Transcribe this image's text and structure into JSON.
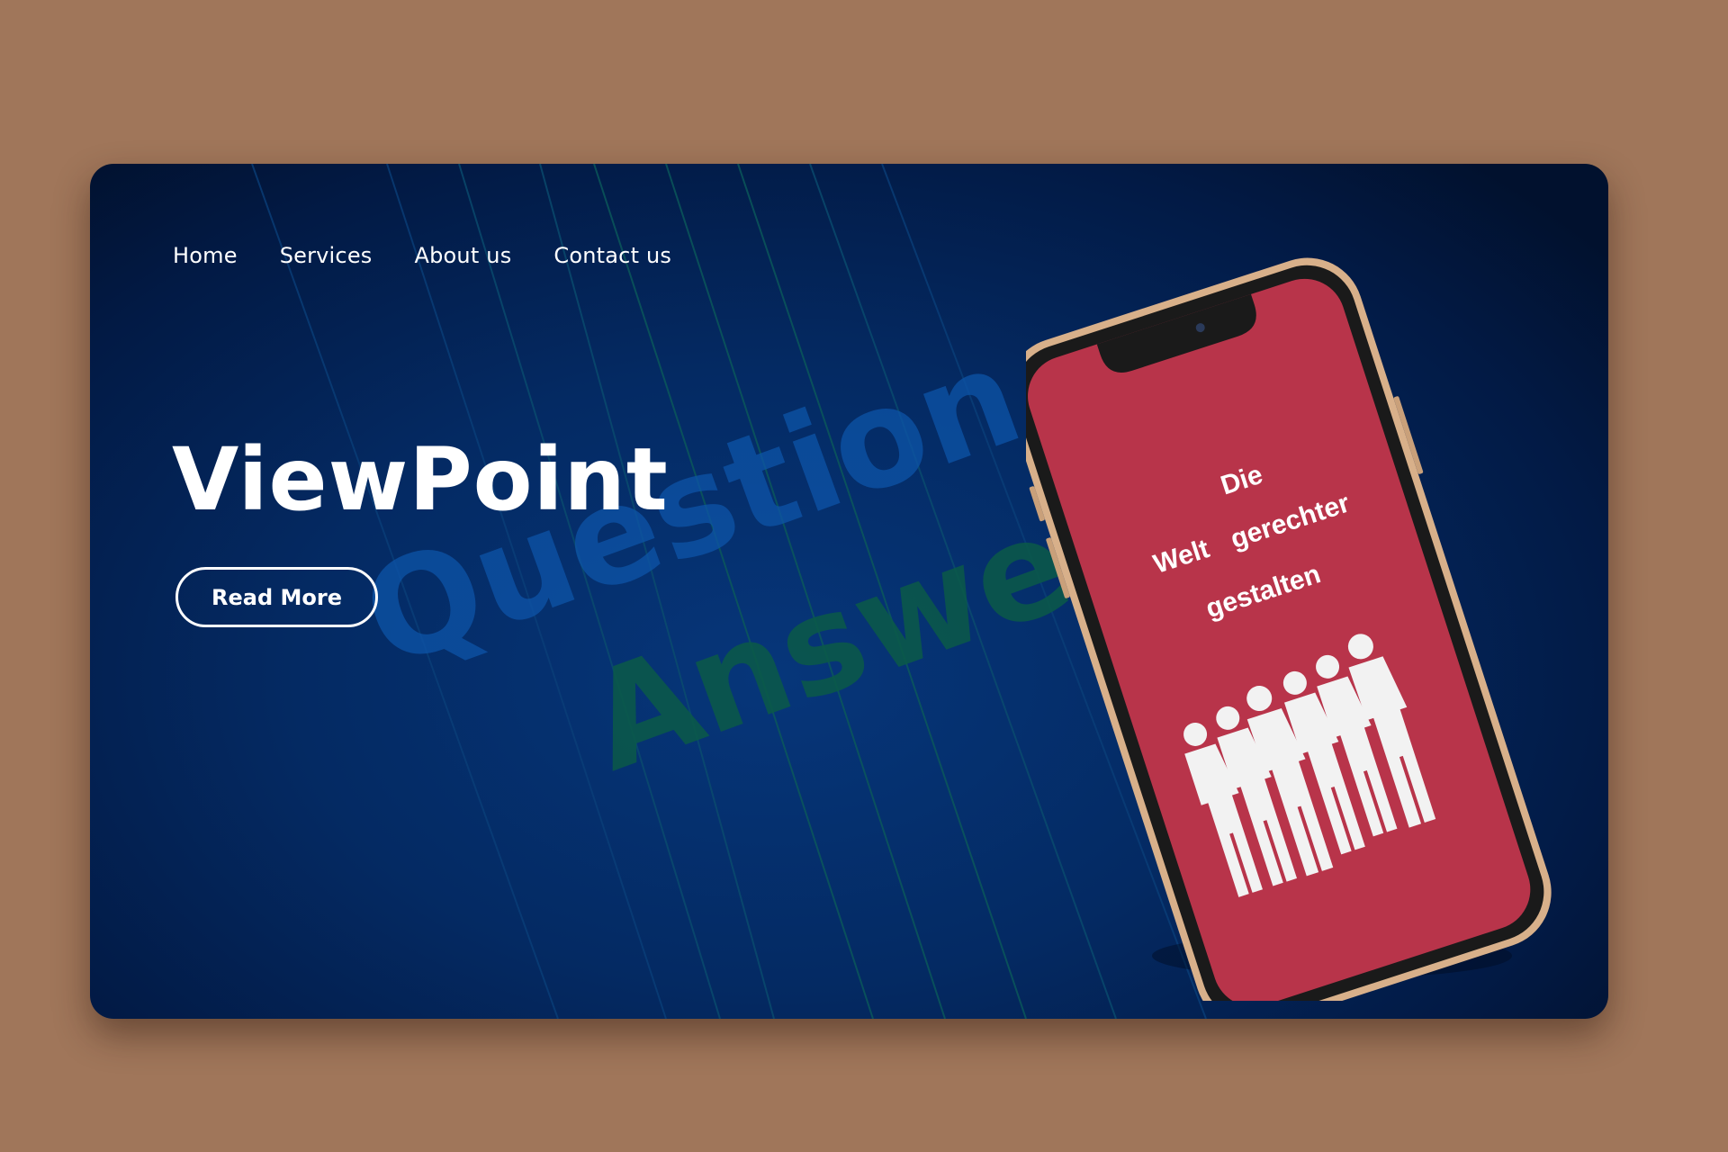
{
  "nav": {
    "home": "Home",
    "services": "Services",
    "about": "About us",
    "contact": "Contact us"
  },
  "hero": {
    "title": "ViewPoint",
    "button_label": "Read More"
  },
  "background_words": {
    "word1": "Question",
    "word2": "Answer"
  },
  "phone_screen": {
    "word_die": "Die",
    "word_welt": "Welt",
    "word_gerechter": "gerechter",
    "word_gestalten": "gestalten"
  },
  "colors": {
    "page_bg": "#a0765a",
    "card_bg": "#042a63",
    "screen_bg": "#b8344a",
    "phone_frame": "#d8b08a"
  }
}
